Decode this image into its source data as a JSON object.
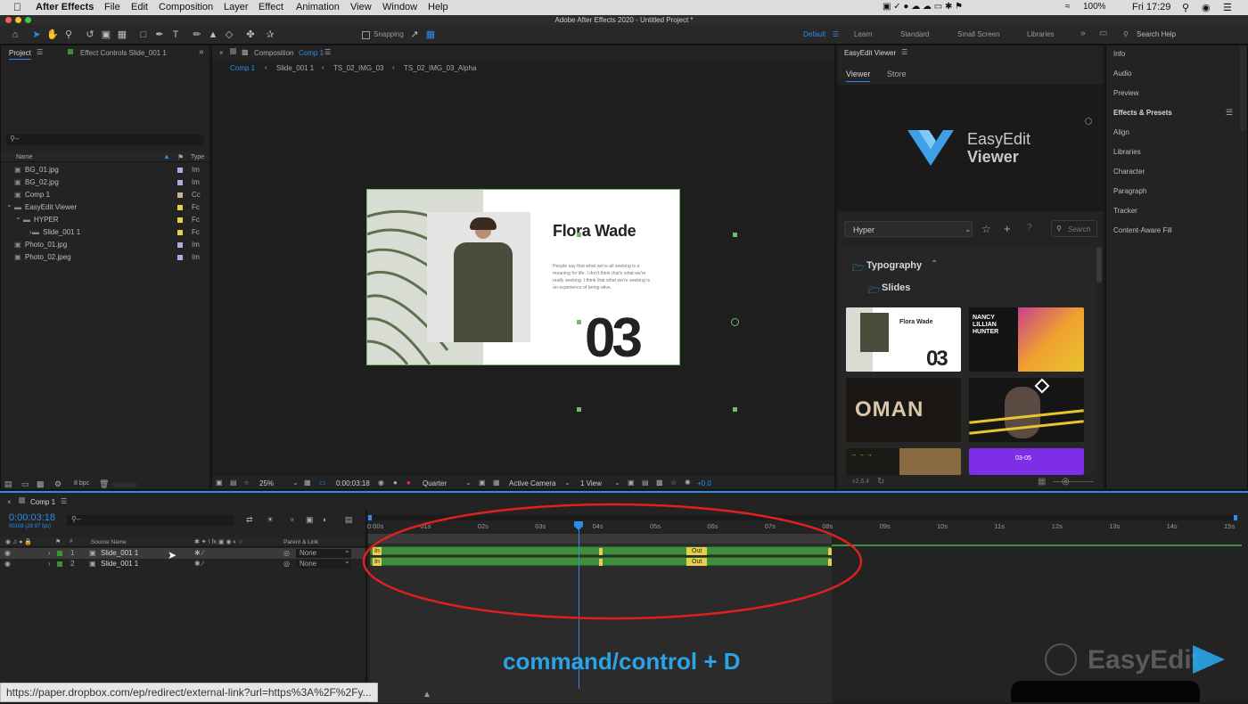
{
  "menubar": {
    "app_name": "After Effects",
    "items": [
      "File",
      "Edit",
      "Composition",
      "Layer",
      "Effect",
      "Animation",
      "View",
      "Window",
      "Help"
    ],
    "battery": "100%",
    "clock": "Fri 17:29"
  },
  "titlebar": {
    "title": "Adobe After Effects 2020 - Untitled Project *"
  },
  "toolbar": {
    "snapping_label": "Snapping",
    "workspaces": [
      "Default",
      "Learn",
      "Standard",
      "Small Screen",
      "Libraries"
    ],
    "active_workspace": "Default",
    "search_placeholder": "Search Help"
  },
  "project_panel": {
    "tab_project": "Project",
    "tab_effect_controls": "Effect Controls Slide_001 1",
    "bpc_label": "8 bpc",
    "col_name": "Name",
    "col_type": "Type",
    "items": [
      {
        "name": "BG_01.jpg",
        "type": "Im",
        "color": "#b9a6e0",
        "indent": 0
      },
      {
        "name": "BG_02.jpg",
        "type": "Im",
        "color": "#b9a6e0",
        "indent": 0
      },
      {
        "name": "Comp 1",
        "type": "Cc",
        "color": "#c9b48a",
        "indent": 0
      },
      {
        "name": "EasyEdit Viewer",
        "type": "Fc",
        "color": "#e3d04e",
        "indent": 0
      },
      {
        "name": "HYPER",
        "type": "Fc",
        "color": "#e3d04e",
        "indent": 1
      },
      {
        "name": "Slide_001 1",
        "type": "Fc",
        "color": "#e3d04e",
        "indent": 2
      },
      {
        "name": "Photo_01.jpg",
        "type": "Im",
        "color": "#b9a6e0",
        "indent": 0
      },
      {
        "name": "Photo_02.jpeg",
        "type": "Im",
        "color": "#b9a6e0",
        "indent": 0
      }
    ]
  },
  "composition_panel": {
    "tab_label": "Composition",
    "tab_comp": "Comp 1",
    "breadcrumbs": [
      "Comp 1",
      "Slide_001 1",
      "TS_02_IMG_03",
      "TS_02_IMG_03_Alpha"
    ],
    "slide": {
      "title": "Flora Wade",
      "body": "People say that what we're all seeking is a meaning for life. I don't think that's what we're really seeking. I think that what we're seeking is an experience of being alive.",
      "number": "03"
    },
    "footer": {
      "zoom": "25%",
      "timecode": "0:00:03:18",
      "resolution": "Quarter",
      "camera": "Active Camera",
      "views": "1 View",
      "exposure": "+0.0"
    }
  },
  "easyedit_panel": {
    "title": "EasyEdit Viewer",
    "tabs": [
      "Viewer",
      "Store"
    ],
    "logo_line1": "EasyEdit",
    "logo_line2": "Viewer",
    "preset": "Hyper",
    "search_placeholder": "Search",
    "category": "Typography",
    "subcategory": "Slides",
    "thumbs": [
      {
        "label": "Flora Wade",
        "sub": "03"
      },
      {
        "label": "NANCY LILLIAN HUNTER"
      },
      {
        "label": "OMAN"
      },
      {
        "label": ""
      },
      {
        "label": ""
      },
      {
        "label": "03-05"
      }
    ],
    "version": "v2.6.4"
  },
  "right_panels": [
    "Info",
    "Audio",
    "Preview",
    "Effects & Presets",
    "Align",
    "Libraries",
    "Character",
    "Paragraph",
    "Tracker",
    "Content-Aware Fill"
  ],
  "timeline": {
    "tab": "Comp 1",
    "timecode": "0:00:03:18",
    "fps": "00108 (29.97 fps)",
    "col_source": "Source Name",
    "col_parent": "Parent & Link",
    "ruler": [
      "0:00s",
      "01s",
      "02s",
      "03s",
      "04s",
      "05s",
      "06s",
      "07s",
      "08s",
      "09s",
      "10s",
      "11s",
      "12s",
      "13s",
      "14s",
      "15s"
    ],
    "layers": [
      {
        "num": "1",
        "name": "Slide_001 1",
        "parent": "None"
      },
      {
        "num": "2",
        "name": "Slide_001 1",
        "parent": "None"
      }
    ],
    "in_label": "In",
    "out_label": "Out",
    "caption": "command/control + D",
    "watermark": "EasyEdit"
  },
  "statusbar": {
    "url": "https://paper.dropbox.com/ep/redirect/external-link?url=https%3A%2F%2Fy..."
  },
  "colors": {
    "accent": "#2d8ceb",
    "label_green": "#3f8f3a",
    "marker_yellow": "#e6cf4a",
    "ellipse_red": "#e0201e",
    "caption_blue": "#2aa4e6"
  }
}
